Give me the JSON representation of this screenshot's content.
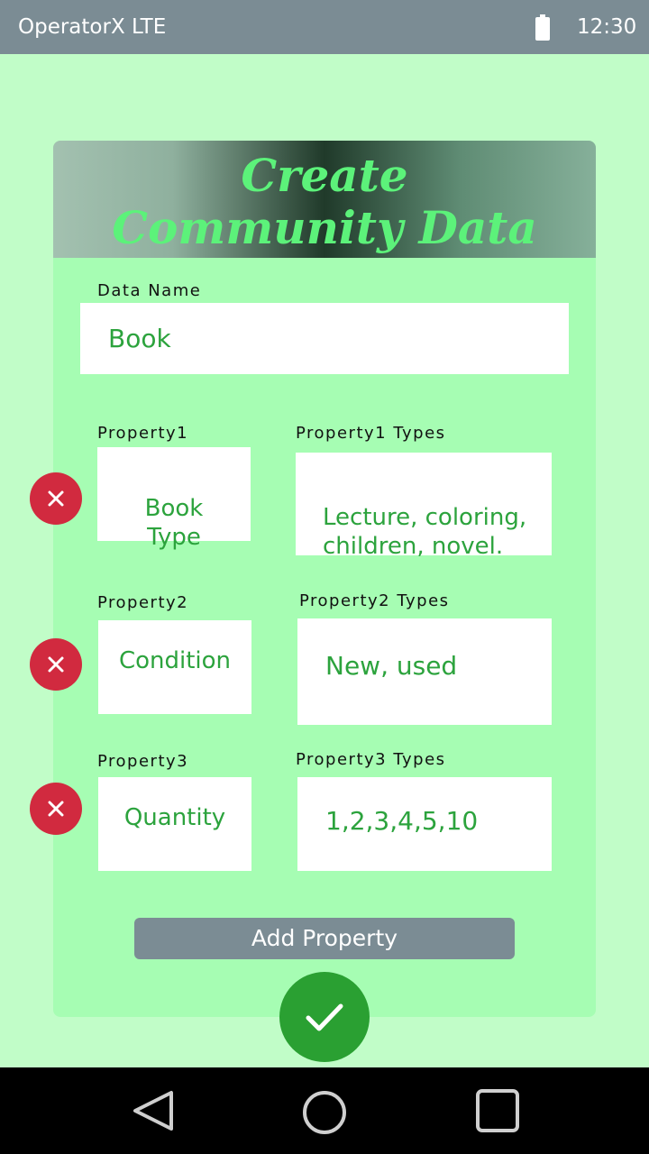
{
  "status": {
    "carrier": "OperatorX LTE",
    "time": "12:30"
  },
  "form": {
    "title_line1": "Create",
    "title_line2": "Community Data",
    "data_name_label": "Data Name",
    "data_name_value": "Book",
    "properties": [
      {
        "label": "Property1",
        "name": "Book\nType",
        "types_label": "Property1 Types",
        "types_value": "Lecture, coloring,\nchildren, novel."
      },
      {
        "label": "Property2",
        "name": "Condition",
        "types_label": "Property2 Types",
        "types_value": "New, used"
      },
      {
        "label": "Property3",
        "name": "Quantity",
        "types_label": "Property3 Types",
        "types_value": "1,2,3,4,5,10"
      }
    ],
    "add_property_label": "Add Property"
  },
  "icons": {
    "battery": "battery-icon",
    "remove": "close-icon",
    "confirm": "checkmark-icon",
    "back": "back-triangle-icon",
    "home": "home-circle-icon",
    "recents": "recents-square-icon"
  },
  "colors": {
    "background": "#c1fdc8",
    "card": "#a6fdb3",
    "accent_text": "#2ca33d",
    "remove": "#d12a3f",
    "confirm": "#2aa032",
    "status_bar": "#7b8c94"
  }
}
